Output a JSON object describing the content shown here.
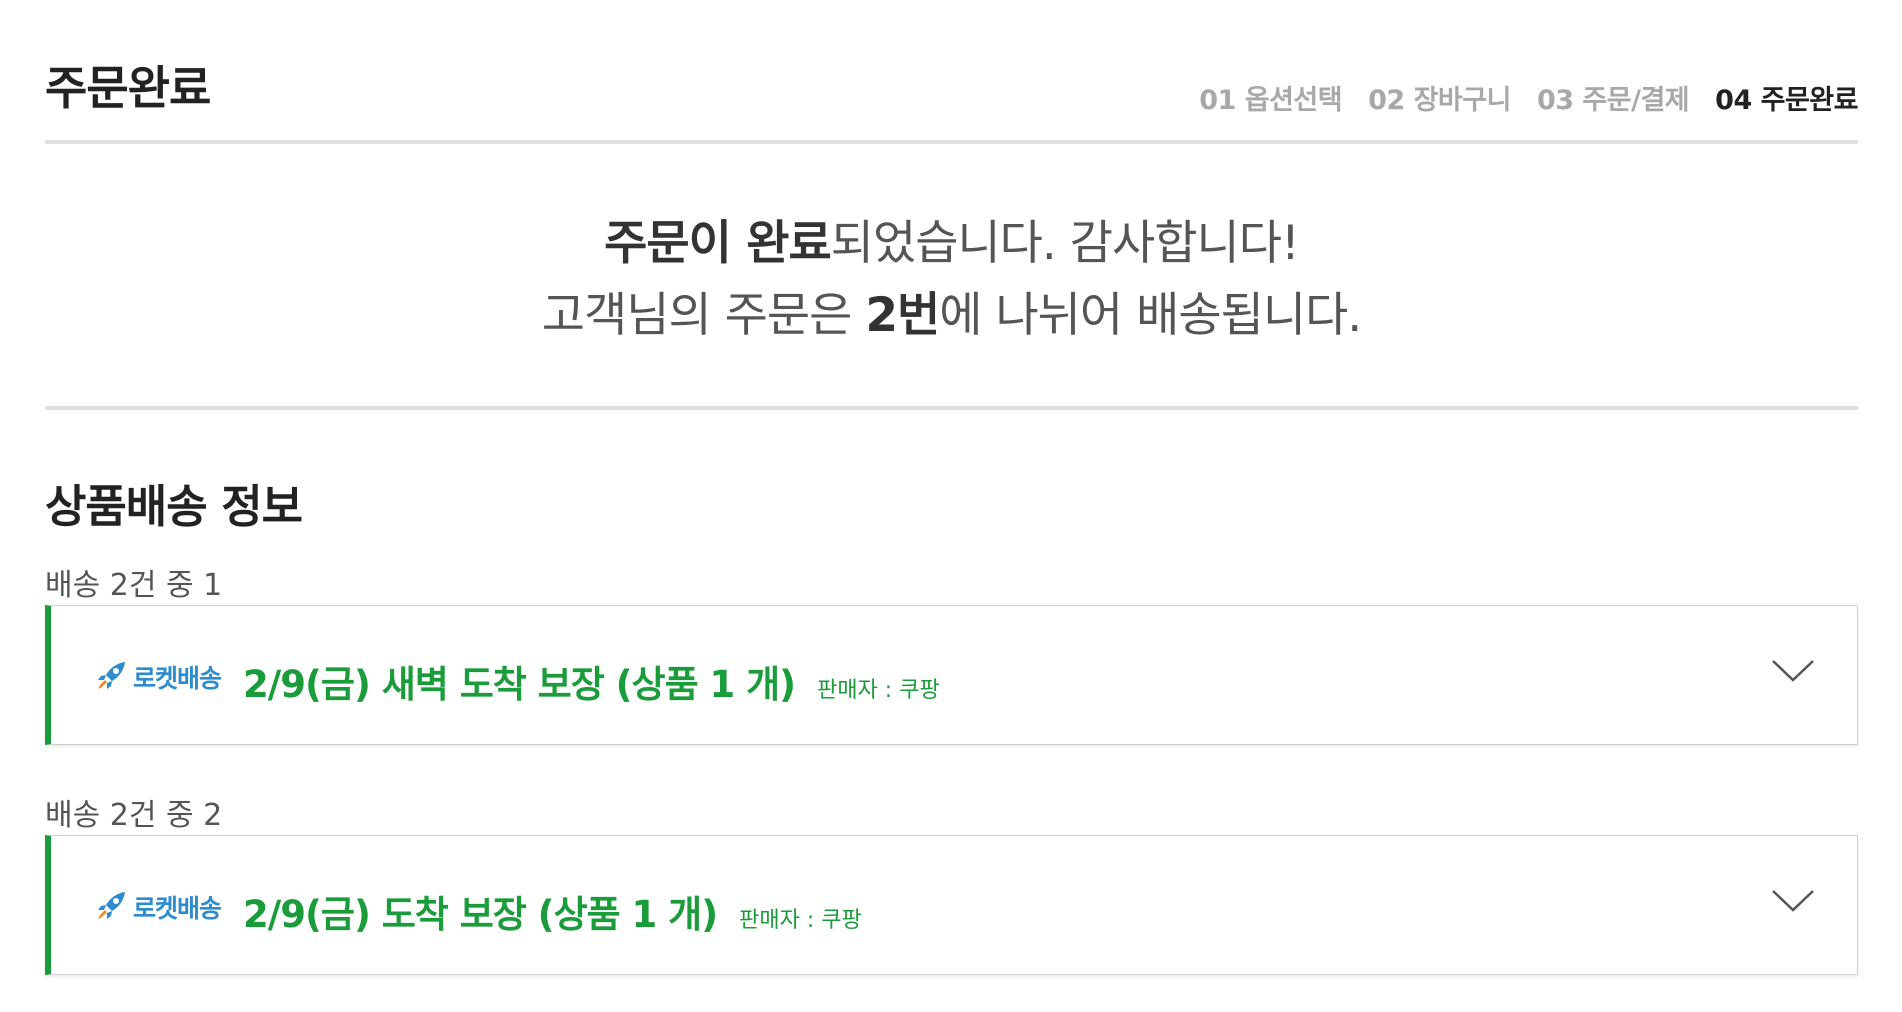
{
  "header": {
    "title": "주문완료",
    "steps": [
      {
        "label": "01 옵션선택",
        "active": false
      },
      {
        "label": "02 장바구니",
        "active": false
      },
      {
        "label": "03 주문/결제",
        "active": false
      },
      {
        "label": "04 주문완료",
        "active": true
      }
    ]
  },
  "complete": {
    "line1_bold": "주문이 완료",
    "line1_rest": "되었습니다. 감사합니다!",
    "line2_pre": "고객님의 주문은 ",
    "line2_bold": "2번",
    "line2_rest": "에 나뉘어 배송됩니다."
  },
  "section": {
    "title": "상품배송 정보"
  },
  "shipments": [
    {
      "label": "배송 2건 중 1",
      "badge_text": "로켓배송",
      "badge_icon": "rocket-icon",
      "summary": "2/9(금) 새벽 도착 보장 (상품 1 개)",
      "seller": "판매자 : 쿠팡",
      "expand_icon": "chevron-down-icon"
    },
    {
      "label": "배송 2건 중 2",
      "badge_text": "로켓배송",
      "badge_icon": "rocket-icon",
      "summary": "2/9(금) 도착 보장 (상품 1 개)",
      "seller": "판매자 : 쿠팡",
      "expand_icon": "chevron-down-icon"
    }
  ],
  "colors": {
    "accent_green": "#1a9c3a",
    "rocket_blue": "#2d8bd0",
    "inactive_step": "#a8a8a8"
  }
}
